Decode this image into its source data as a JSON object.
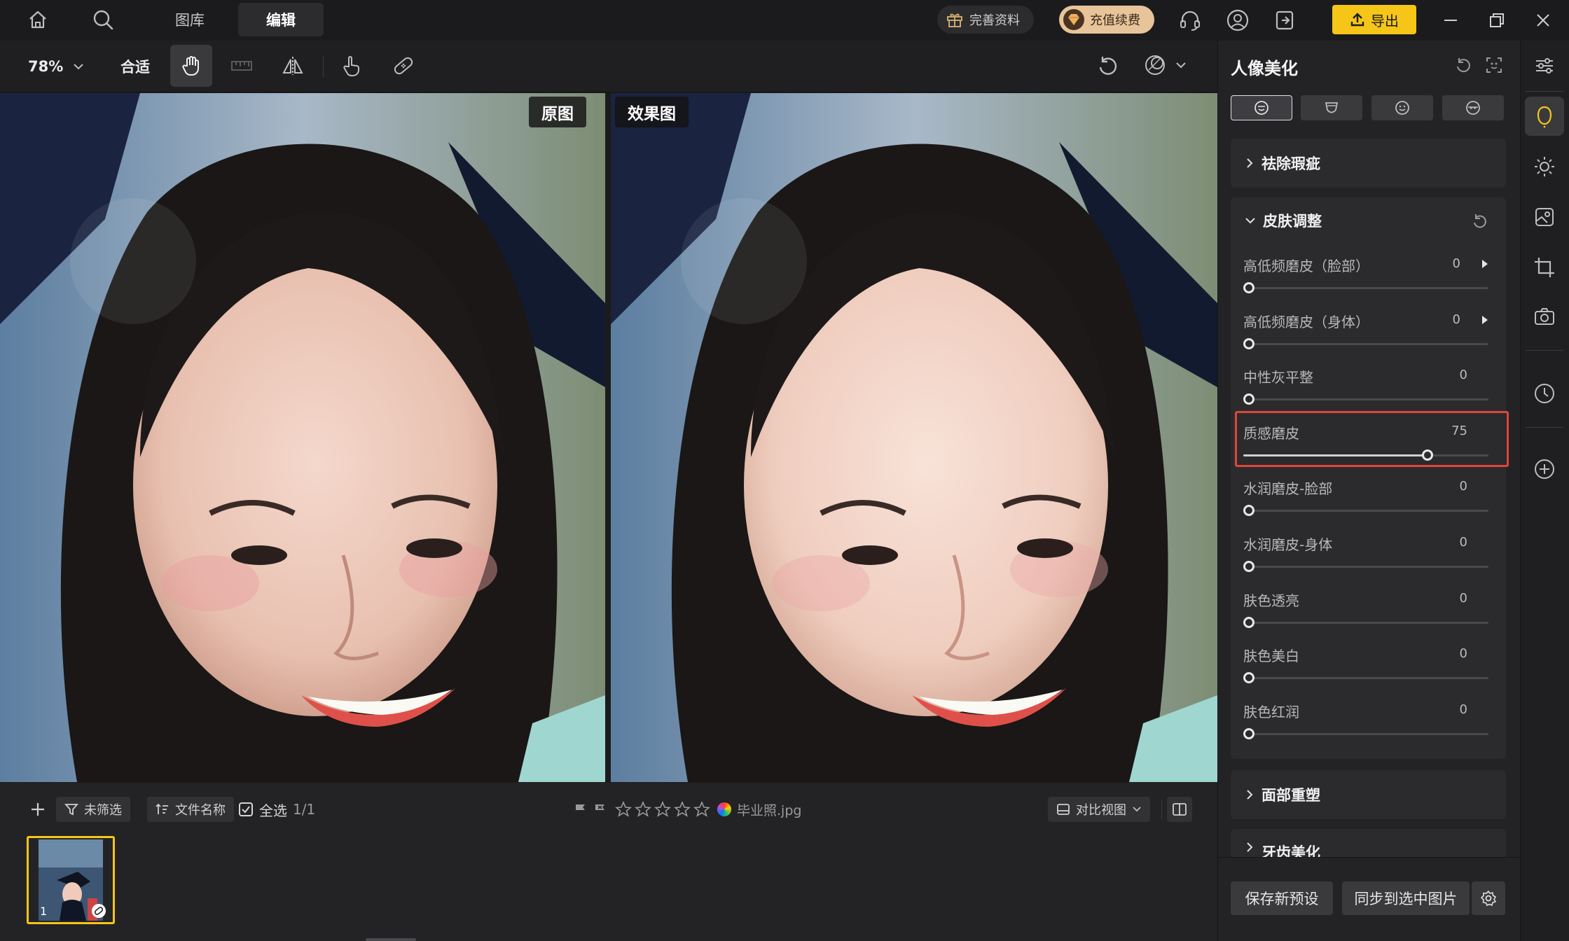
{
  "colors": {
    "accent_yellow": "#f5c518",
    "highlight_red": "#e0453a",
    "bg": "#1b1b1d",
    "panel": "#232325"
  },
  "topbar": {
    "tabs": [
      {
        "label": "图库"
      },
      {
        "label": "编辑"
      }
    ],
    "active_tab": "编辑",
    "complete_profile": "完善资料",
    "recharge": "充值续费",
    "export": "导出"
  },
  "toolbar": {
    "zoom": "78%",
    "fit": "合适"
  },
  "view": {
    "original_label": "原图",
    "effect_label": "效果图"
  },
  "bottom": {
    "filter": "未筛选",
    "sort": "文件名称",
    "select_all": "全选",
    "count": "1/1",
    "filename": "毕业照.jpg",
    "rating": 0,
    "rating_max": 5,
    "compare_view": "对比视图",
    "thumb_index": "1"
  },
  "panel": {
    "title": "人像美化",
    "sections": {
      "blemish": "祛除瑕疵",
      "skin": "皮肤调整",
      "face": "面部重塑",
      "teeth": "牙齿美化"
    },
    "sliders": [
      {
        "label": "高低频磨皮（脸部）",
        "value": "0",
        "has_arrow": true
      },
      {
        "label": "高低频磨皮（身体）",
        "value": "0",
        "has_arrow": true
      },
      {
        "label": "中性灰平整",
        "value": "0"
      },
      {
        "label": "质感磨皮",
        "value": "75",
        "highlighted": true,
        "fraction": 0.75
      },
      {
        "label": "水润磨皮-脸部",
        "value": "0"
      },
      {
        "label": "水润磨皮-身体",
        "value": "0"
      },
      {
        "label": "肤色透亮",
        "value": "0"
      },
      {
        "label": "肤色美白",
        "value": "0"
      },
      {
        "label": "肤色红润",
        "value": "0"
      }
    ],
    "save_preset": "保存新预设",
    "sync": "同步到选中图片"
  }
}
